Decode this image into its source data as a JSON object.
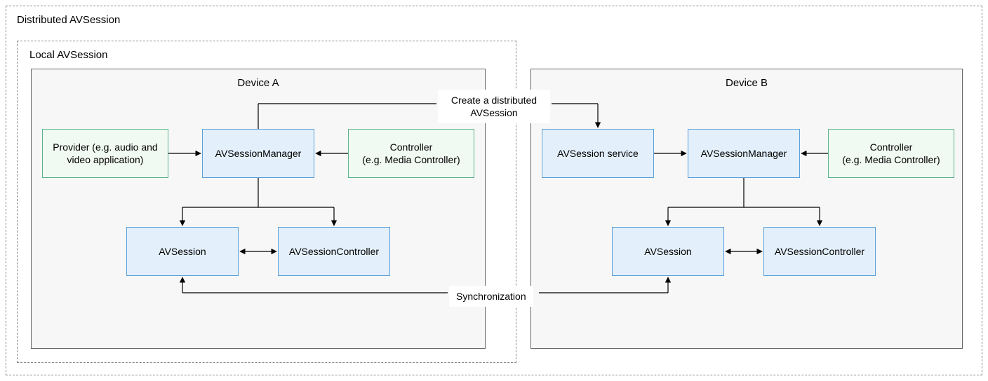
{
  "outer_label": "Distributed AVSession",
  "local_label": "Local AVSession",
  "deviceA": {
    "title": "Device A",
    "provider": "Provider (e.g. audio and video application)",
    "manager": "AVSessionManager",
    "controller": "Controller\n(e.g. Media Controller)",
    "session": "AVSession",
    "session_controller": "AVSessionController"
  },
  "deviceB": {
    "title": "Device B",
    "service": "AVSession service",
    "manager": "AVSessionManager",
    "controller": "Controller\n(e.g. Media Controller)",
    "session": "AVSession",
    "session_controller": "AVSessionController"
  },
  "labels": {
    "create": "Create a distributed\nAVSession",
    "sync": "Synchronization"
  }
}
